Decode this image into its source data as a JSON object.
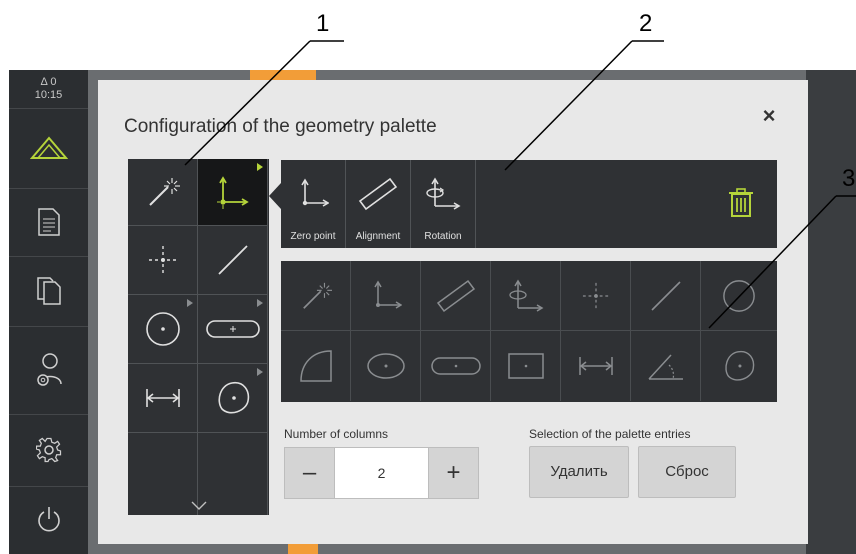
{
  "sidebar": {
    "status_line1": "Δ 0",
    "status_line2": "10:15",
    "items": [
      {
        "icon": "measure-icon",
        "active": true
      },
      {
        "icon": "document-icon"
      },
      {
        "icon": "file-copy-icon"
      },
      {
        "icon": "user-settings-icon"
      },
      {
        "icon": "gear-icon"
      },
      {
        "icon": "power-icon"
      }
    ]
  },
  "dialog": {
    "title": "Configuration of the geometry palette",
    "close_label": "×"
  },
  "palette": {
    "items": [
      {
        "icon": "measure-wand-icon"
      },
      {
        "icon": "zero-point-icon",
        "selected": true,
        "submenu": true
      },
      {
        "icon": "point-icon"
      },
      {
        "icon": "line-icon"
      },
      {
        "icon": "circle-icon",
        "submenu": true
      },
      {
        "icon": "slot-icon",
        "submenu": true
      },
      {
        "icon": "distance-icon"
      },
      {
        "icon": "freeform-icon",
        "submenu": true
      }
    ]
  },
  "strip": {
    "items": [
      {
        "label": "Zero point",
        "icon": "zero-point-icon"
      },
      {
        "label": "Alignment",
        "icon": "alignment-icon"
      },
      {
        "label": "Rotation",
        "icon": "rotation-icon"
      }
    ],
    "trash_icon": "trash-icon",
    "accent_color": "#b5d43a"
  },
  "grid": {
    "items": [
      "measure-wand-icon",
      "zero-point-icon",
      "alignment-icon",
      "rotation-icon",
      "point-icon",
      "line-icon",
      "circle-icon",
      "arc-icon",
      "ellipse-icon",
      "slot-icon",
      "rectangle-icon",
      "distance-icon",
      "angle-icon",
      "freeform-icon"
    ]
  },
  "columns": {
    "label": "Number of columns",
    "value": "2",
    "minus": "–",
    "plus": "+"
  },
  "selection": {
    "label": "Selection of the palette entries",
    "delete_button": "Удалить",
    "reset_button": "Сброс"
  },
  "callouts": [
    "1",
    "2",
    "3"
  ],
  "colors": {
    "sidebar_bg": "#2b2e31",
    "accent_orange": "#f29d38",
    "dialog_bg": "#e8e8e8",
    "panel_bg": "#2f3134"
  }
}
